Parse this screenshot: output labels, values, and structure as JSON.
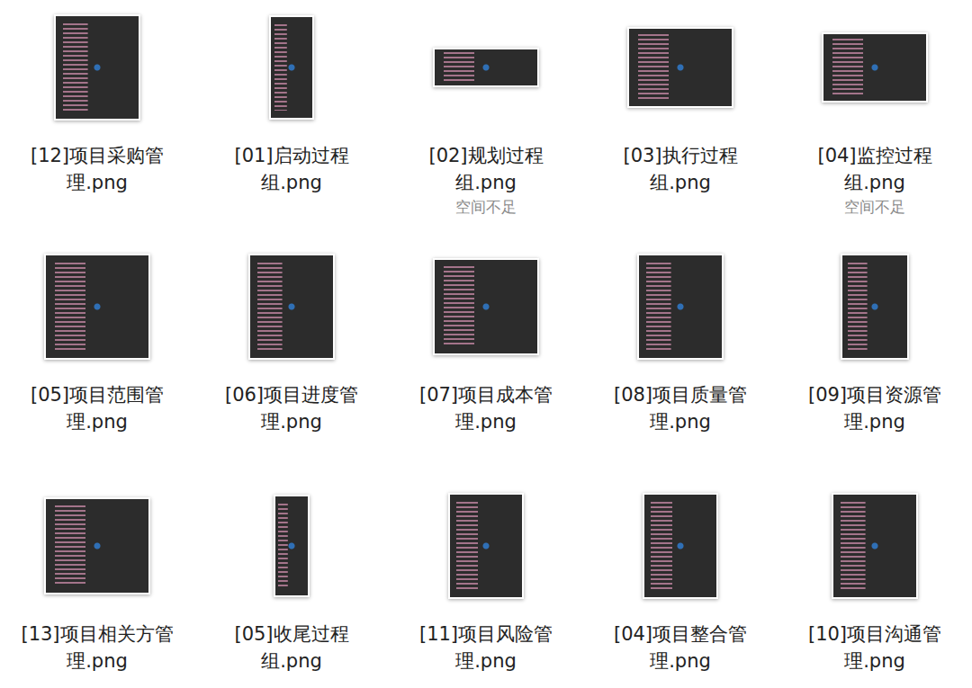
{
  "window": {
    "view": "icon-grid"
  },
  "files": [
    {
      "lines": [
        "[12]项目采购管",
        "理.png"
      ],
      "kind": "portrait"
    },
    {
      "lines": [
        "[01]启动过程",
        "组.png"
      ],
      "kind": "tall"
    },
    {
      "lines": [
        "[02]规划过程",
        "组.png"
      ],
      "status": "空间不足",
      "kind": "wide"
    },
    {
      "lines": [
        "[03]执行过程",
        "组.png"
      ],
      "kind": "landscape"
    },
    {
      "lines": [
        "[04]监控过程",
        "组.png"
      ],
      "status": "空间不足",
      "kind": "short"
    },
    {
      "lines": [
        "[05]项目范围管",
        "理.png"
      ],
      "kind": "square"
    },
    {
      "lines": [
        "[06]项目进度管",
        "理.png"
      ],
      "kind": "portrait"
    },
    {
      "lines": [
        "[07]项目成本管",
        "理.png"
      ],
      "kind": "box"
    },
    {
      "lines": [
        "[08]项目质量管",
        "理.png"
      ],
      "kind": "portrait"
    },
    {
      "lines": [
        "[09]项目资源管",
        "理.png"
      ],
      "kind": "slim"
    },
    {
      "lines": [
        "[13]项目相关方管",
        "理.png"
      ],
      "kind": "box"
    },
    {
      "lines": [
        "[05]收尾过程",
        "组.png"
      ],
      "kind": "narrow"
    },
    {
      "lines": [
        "[11]项目风险管",
        "理.png"
      ],
      "kind": "medium"
    },
    {
      "lines": [
        "[04]项目整合管",
        "理.png"
      ],
      "kind": "medium"
    },
    {
      "lines": [
        "[10]项目沟通管",
        "理.png"
      ],
      "kind": "portrait"
    }
  ]
}
